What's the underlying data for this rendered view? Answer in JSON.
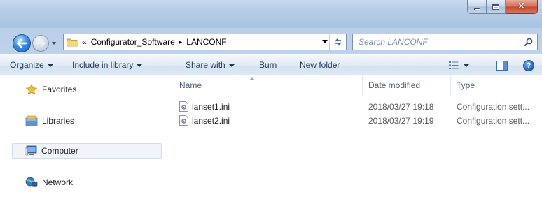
{
  "window": {
    "caption_buttons": {
      "minimize": "minimize-icon",
      "maximize": "maximize-icon",
      "close": "close-icon"
    }
  },
  "address": {
    "overflow": "«",
    "path": [
      "Configurator_Software",
      "LANCONF"
    ],
    "separator": "▸"
  },
  "search": {
    "placeholder": "Search LANCONF"
  },
  "toolbar": {
    "organize": "Organize",
    "include_in_library": "Include in library",
    "share_with": "Share with",
    "burn": "Burn",
    "new_folder": "New folder"
  },
  "navigation": {
    "items": [
      {
        "label": "Favorites",
        "icon": "star-icon"
      },
      {
        "label": "Libraries",
        "icon": "libraries-icon"
      },
      {
        "label": "Computer",
        "icon": "computer-icon",
        "selected": true
      },
      {
        "label": "Network",
        "icon": "network-icon"
      }
    ]
  },
  "columns": {
    "name": "Name",
    "date_modified": "Date modified",
    "type": "Type"
  },
  "files": [
    {
      "name": "lanset1.ini",
      "date_modified": "2018/03/27 19:18",
      "type": "Configuration sett..."
    },
    {
      "name": "lanset2.ini",
      "date_modified": "2018/03/27 19:19",
      "type": "Configuration sett..."
    }
  ],
  "colors": {
    "accent": "#1e395b",
    "titlebar": "#b6cde8",
    "selection": "#f1f4f8"
  }
}
